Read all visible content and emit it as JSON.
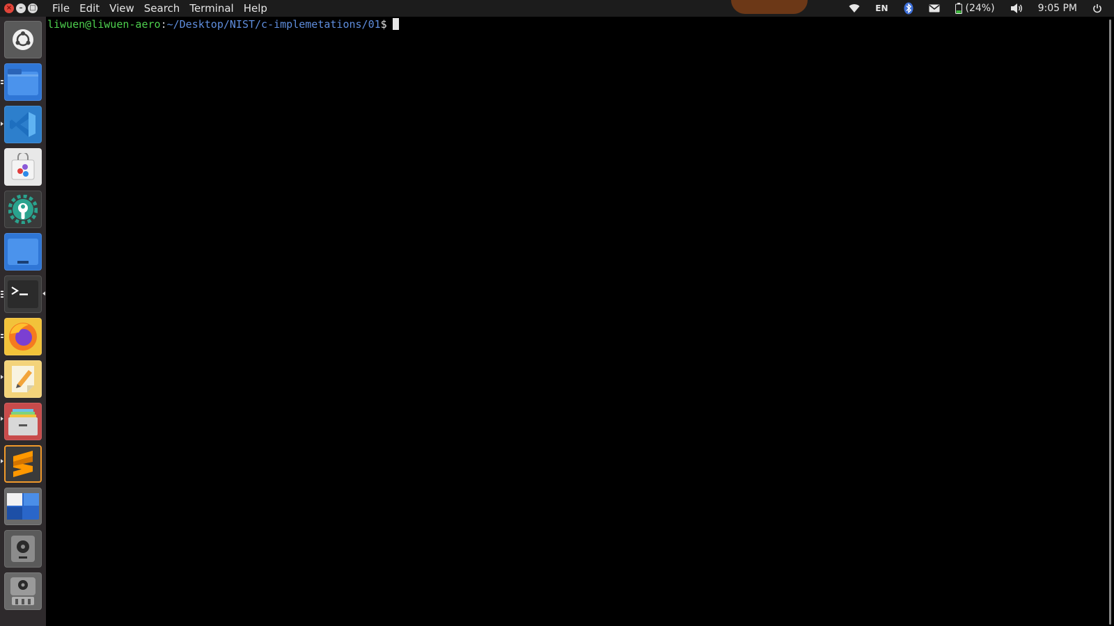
{
  "window_controls": {
    "close": "×",
    "minimize": "–",
    "maximize": "□"
  },
  "menu": [
    "File",
    "Edit",
    "View",
    "Search",
    "Terminal",
    "Help"
  ],
  "indicators": {
    "language": "EN",
    "battery": "(24%)",
    "clock": "9:05 PM"
  },
  "launcher": [
    {
      "name": "ubuntu-dash-icon"
    },
    {
      "name": "files-icon"
    },
    {
      "name": "vscode-icon"
    },
    {
      "name": "software-center-icon"
    },
    {
      "name": "system-settings-icon"
    },
    {
      "name": "workspace-switcher-icon"
    },
    {
      "name": "terminal-icon"
    },
    {
      "name": "firefox-icon"
    },
    {
      "name": "text-editor-icon"
    },
    {
      "name": "file-manager-icon"
    },
    {
      "name": "sublime-text-icon"
    },
    {
      "name": "desktop-icon"
    },
    {
      "name": "drive-icon"
    },
    {
      "name": "usb-drive-icon"
    }
  ],
  "terminal": {
    "user_host": "liwuen@liwuen-aero",
    "colon": ":",
    "path": "~/Desktop/NIST/c-implemetations/01",
    "prompt_char": "$"
  },
  "colors": {
    "user": "#4ed14e",
    "path": "#5f8ede",
    "panel": "#1c1c1c",
    "launcher": "#2e2a2c"
  }
}
